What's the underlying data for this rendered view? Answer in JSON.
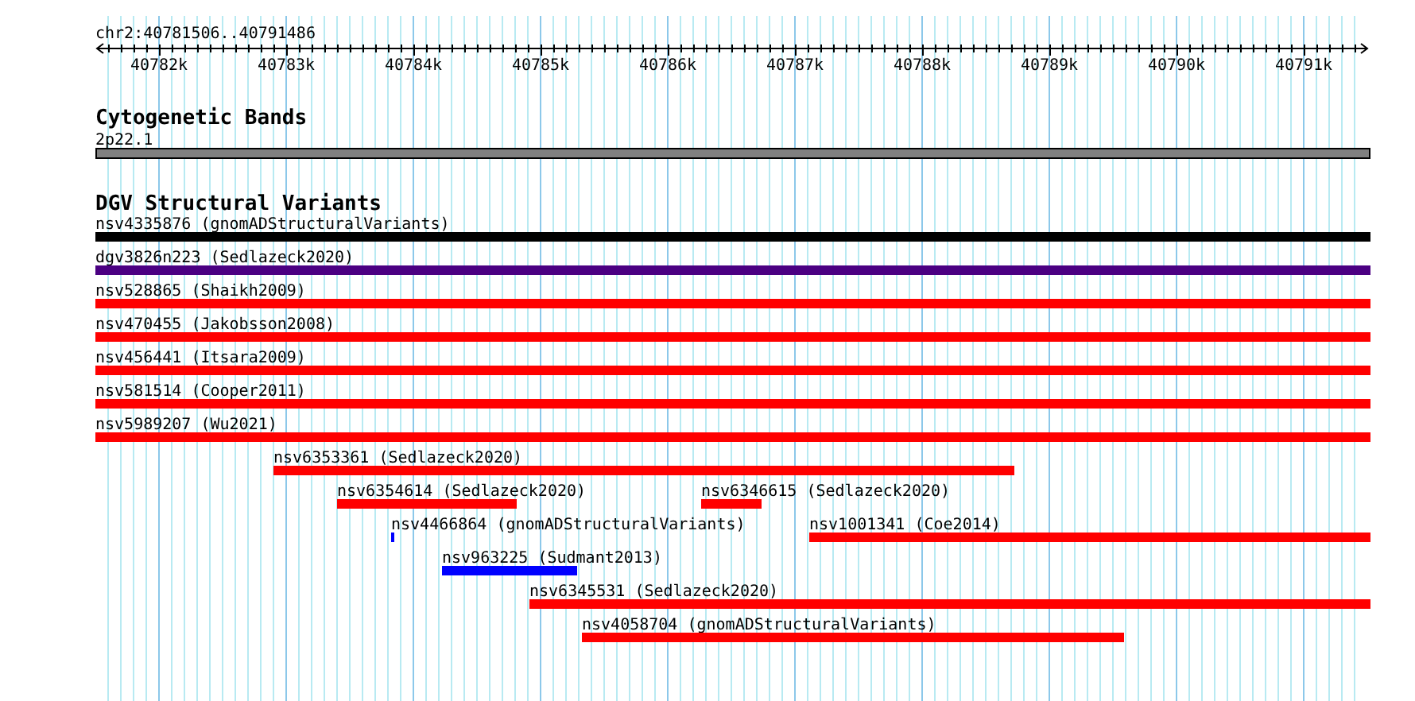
{
  "ruler": {
    "locus": "chr2:40781506..40791486",
    "ticks": [
      "40782k",
      "40783k",
      "40784k",
      "40785k",
      "40786k",
      "40787k",
      "40788k",
      "40789k",
      "40790k",
      "40791k"
    ]
  },
  "cytoband_track": {
    "title": "Cytogenetic Bands",
    "band": "2p22.1"
  },
  "dgv_track": {
    "title": "DGV Structural Variants",
    "features": [
      {
        "label": "nsv4335876 (gnomADStructuralVariants)",
        "color": "#000000"
      },
      {
        "label": "dgv3826n223 (Sedlazeck2020)",
        "color": "#4b0082"
      },
      {
        "label": "nsv528865 (Shaikh2009)",
        "color": "#ff0000"
      },
      {
        "label": "nsv470455 (Jakobsson2008)",
        "color": "#ff0000"
      },
      {
        "label": "nsv456441 (Itsara2009)",
        "color": "#ff0000"
      },
      {
        "label": "nsv581514 (Cooper2011)",
        "color": "#ff0000"
      },
      {
        "label": "nsv5989207 (Wu2021)",
        "color": "#ff0000"
      },
      {
        "label": "nsv6353361 (Sedlazeck2020)",
        "color": "#ff0000"
      },
      {
        "label": "nsv6354614 (Sedlazeck2020)",
        "color": "#ff0000"
      },
      {
        "label": "nsv6346615 (Sedlazeck2020)",
        "color": "#ff0000"
      },
      {
        "label": "nsv4466864 (gnomADStructuralVariants)",
        "color": "#0000ff"
      },
      {
        "label": "nsv1001341 (Coe2014)",
        "color": "#ff0000"
      },
      {
        "label": "nsv963225 (Sudmant2013)",
        "color": "#0000ff"
      },
      {
        "label": "nsv6345531 (Sedlazeck2020)",
        "color": "#ff0000"
      },
      {
        "label": "nsv4058704 (gnomADStructuralVariants)",
        "color": "#ff0000"
      }
    ]
  }
}
